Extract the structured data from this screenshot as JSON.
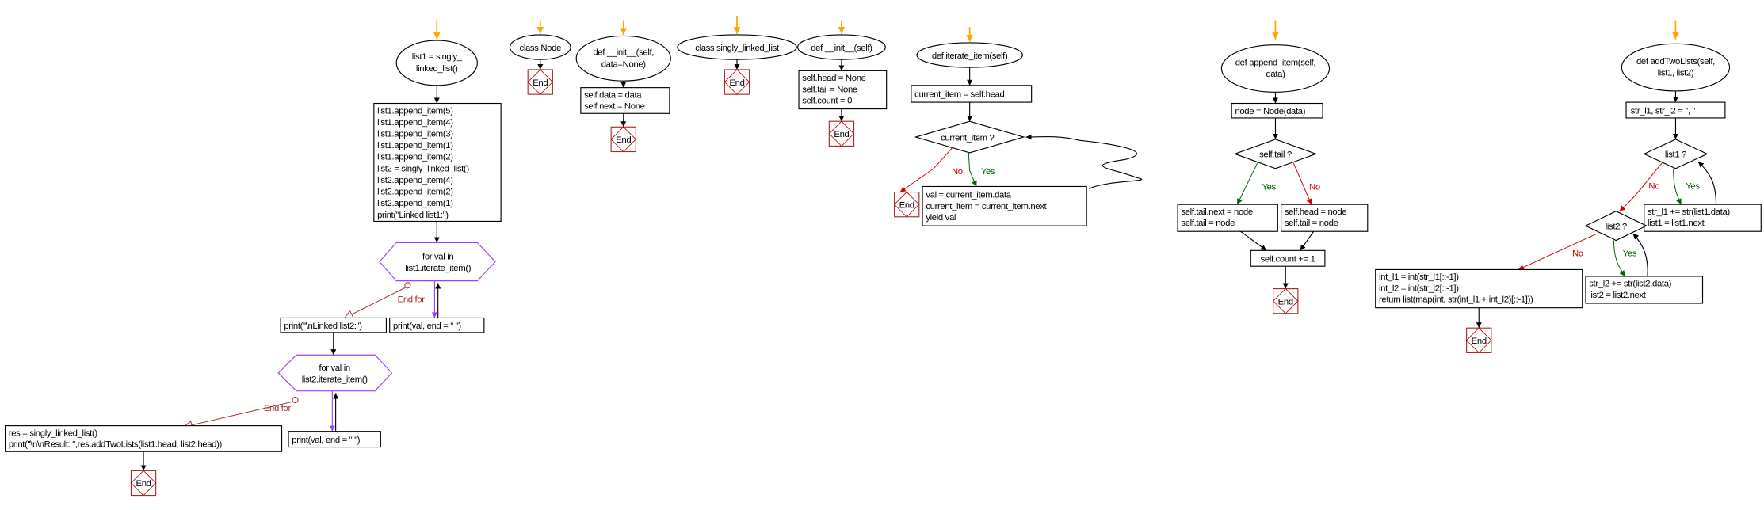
{
  "colors": {
    "start_arrow": "#ffa500",
    "end_box": "#a52a2a",
    "loop": "#a040ff",
    "no": "#d00000",
    "yes": "#006400"
  },
  "labels": {
    "end": "End",
    "end_for": "End for",
    "yes": "Yes",
    "no": "No"
  },
  "main": {
    "start": [
      "list1 = singly_",
      "linked_list()"
    ],
    "init_lines": [
      "list1.append_item(5)",
      "list1.append_item(4)",
      "list1.append_item(3)",
      "list1.append_item(1)",
      "list1.append_item(2)",
      "list2 = singly_linked_list()",
      "list2.append_item(4)",
      "list2.append_item(2)",
      "list2.append_item(1)",
      "print(\"Linked list1:\")"
    ],
    "for1": [
      "for val in",
      "list1.iterate_item()"
    ],
    "print_list2": "print(\"\\nLinked list2:\")",
    "print_val": "print(val, end = \" \")",
    "for2": [
      "for val in",
      "list2.iterate_item()"
    ],
    "result_lines": [
      "res = singly_linked_list()",
      "print(\"\\n\\nResult: \",res.addTwoLists(list1.head, list2.head))"
    ]
  },
  "node_class": {
    "start": "class Node"
  },
  "node_init": {
    "start": [
      "def __init__(self,",
      "data=None)"
    ],
    "body": [
      "self.data = data",
      "self.next = None"
    ]
  },
  "sll_class": {
    "start": "class singly_linked_list"
  },
  "sll_init": {
    "start": "def __init__(self)",
    "body": [
      "self.head = None",
      "self.tail = None",
      "self.count = 0"
    ]
  },
  "iterate": {
    "start": "def iterate_item(self)",
    "init": "current_item = self.head",
    "cond": "current_item ?",
    "body": [
      "val = current_item.data",
      "current_item = current_item.next",
      "yield val"
    ]
  },
  "append": {
    "start": [
      "def append_item(self,",
      "data)"
    ],
    "init": "node = Node(data)",
    "cond": "self.tail ?",
    "yes_body": [
      "self.tail.next = node",
      "self.tail = node"
    ],
    "no_body": [
      "self.head = node",
      "self.tail = node"
    ],
    "after": "self.count += 1"
  },
  "add_two": {
    "start": [
      "def addTwoLists(self,",
      "list1, list2)"
    ],
    "init": "str_l1, str_l2 = \", \"",
    "cond1": "list1 ?",
    "body1": [
      "str_l1  += str(list1.data)",
      "list1 = list1.next"
    ],
    "cond2": "list2 ?",
    "body2": [
      "str_l2  += str(list2.data)",
      "list2 = list2.next"
    ],
    "final": [
      "int_l1 = int(str_l1[::-1])",
      "int_l2 = int(str_l2[::-1])",
      "return list(map(int, str(int_l1 + int_l2)[::-1]))"
    ]
  }
}
